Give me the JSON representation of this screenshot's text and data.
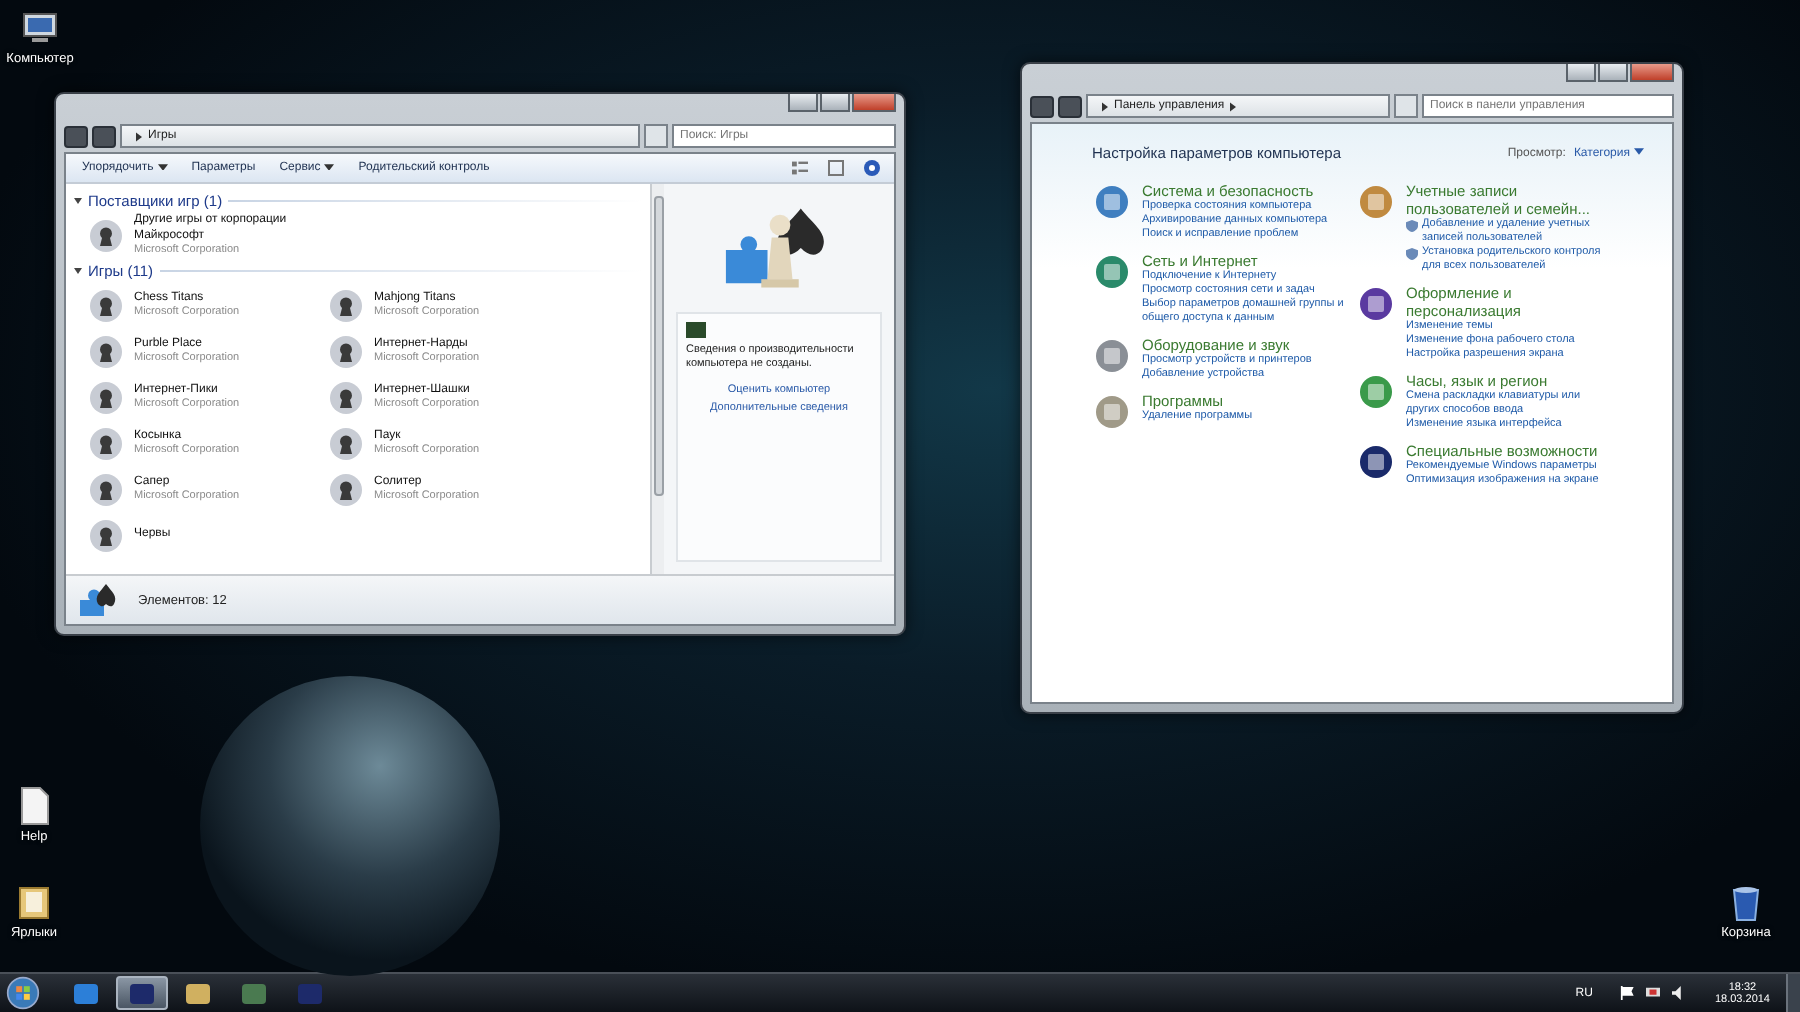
{
  "desktop_icons": [
    {
      "label": "Компьютер",
      "kind": "computer"
    },
    {
      "label": "Help",
      "kind": "document"
    },
    {
      "label": "Ярлыки",
      "kind": "folder"
    },
    {
      "label": "Корзина",
      "kind": "bin"
    }
  ],
  "games_window": {
    "address": "Игры",
    "search": {
      "placeholder": "Поиск: Игры"
    },
    "toolbar": [
      {
        "label": "Упорядочить",
        "dropdown": true
      },
      {
        "label": "Параметры",
        "dropdown": false
      },
      {
        "label": "Сервис",
        "dropdown": true
      },
      {
        "label": "Родительский контроль",
        "dropdown": false
      }
    ],
    "groups": [
      {
        "title": "Поставщики игр (1)",
        "expanded": true,
        "items": [
          {
            "name": "Другие игры от корпорации Майкрософт",
            "publisher": "Microsoft Corporation"
          }
        ]
      },
      {
        "title": "Игры (11)",
        "expanded": true,
        "items": [
          {
            "name": "Chess Titans",
            "publisher": "Microsoft Corporation"
          },
          {
            "name": "Mahjong Titans",
            "publisher": "Microsoft Corporation"
          },
          {
            "name": "Purble Place",
            "publisher": "Microsoft Corporation"
          },
          {
            "name": "Интернет-Нарды",
            "publisher": "Microsoft Corporation"
          },
          {
            "name": "Интернет-Пики",
            "publisher": "Microsoft Corporation"
          },
          {
            "name": "Интернет-Шашки",
            "publisher": "Microsoft Corporation"
          },
          {
            "name": "Косынка",
            "publisher": "Microsoft Corporation"
          },
          {
            "name": "Паук",
            "publisher": "Microsoft Corporation"
          },
          {
            "name": "Сапер",
            "publisher": "Microsoft Corporation"
          },
          {
            "name": "Солитер",
            "publisher": "Microsoft Corporation"
          },
          {
            "name": "Червы"
          }
        ]
      }
    ],
    "preview": {
      "message": "Сведения о производительности компьютера не созданы.",
      "links": [
        "Оценить компьютер",
        "Дополнительные сведения"
      ]
    },
    "status": "Элементов: 12"
  },
  "control_panel": {
    "address": "Панель управления",
    "search": {
      "placeholder": "Поиск в панели управления"
    },
    "heading": "Настройка параметров компьютера",
    "view_label": "Просмотр:",
    "view_value": "Категория",
    "columns": [
      [
        {
          "title": "Система и безопасность",
          "kind": "security",
          "links": [
            {
              "text": "Проверка состояния компьютера",
              "shield": false
            },
            {
              "text": "Архивирование данных компьютера",
              "shield": false
            },
            {
              "text": "Поиск и исправление проблем",
              "shield": false
            }
          ]
        },
        {
          "title": "Сеть и Интернет",
          "kind": "network",
          "links": [
            {
              "text": "Подключение к Интернету",
              "shield": false
            },
            {
              "text": "Просмотр состояния сети и задач",
              "shield": false
            },
            {
              "text": "Выбор параметров домашней группы и общего доступа к данным",
              "shield": false
            }
          ]
        },
        {
          "title": "Оборудование и звук",
          "kind": "hardware",
          "links": [
            {
              "text": "Просмотр устройств и принтеров",
              "shield": false
            },
            {
              "text": "Добавление устройства",
              "shield": false
            }
          ]
        },
        {
          "title": "Программы",
          "kind": "programs",
          "links": [
            {
              "text": "Удаление программы",
              "shield": false
            }
          ]
        }
      ],
      [
        {
          "title": "Учетные записи пользователей и семейн...",
          "kind": "users",
          "links": [
            {
              "text": "Добавление и удаление учетных записей пользователей",
              "shield": true
            },
            {
              "text": "Установка родительского контроля для всех пользователей",
              "shield": true
            }
          ]
        },
        {
          "title": "Оформление и персонализация",
          "kind": "appearance",
          "links": [
            {
              "text": "Изменение темы",
              "shield": false
            },
            {
              "text": "Изменение фона рабочего стола",
              "shield": false
            },
            {
              "text": "Настройка разрешения экрана",
              "shield": false
            }
          ]
        },
        {
          "title": "Часы, язык и регион",
          "kind": "clock",
          "links": [
            {
              "text": "Смена раскладки клавиатуры или других способов ввода",
              "shield": false
            },
            {
              "text": "Изменение языка интерфейса",
              "shield": false
            }
          ]
        },
        {
          "title": "Специальные возможности",
          "kind": "access",
          "links": [
            {
              "text": "Рекомендуемые Windows параметры",
              "shield": false
            },
            {
              "text": "Оптимизация изображения на экране",
              "shield": false
            }
          ]
        }
      ]
    ]
  },
  "taskbar": {
    "buttons": [
      {
        "kind": "ie",
        "selected": false
      },
      {
        "kind": "window",
        "selected": true
      },
      {
        "kind": "media",
        "selected": false
      },
      {
        "kind": "panel",
        "selected": false
      },
      {
        "kind": "window",
        "selected": false
      }
    ],
    "language": "RU",
    "time": "18:32",
    "date": "18.03.2014"
  }
}
